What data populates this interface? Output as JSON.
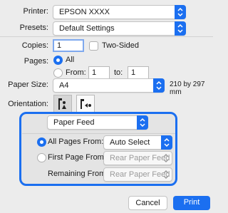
{
  "printer": {
    "label": "Printer:",
    "value": "EPSON XXXX"
  },
  "presets": {
    "label": "Presets:",
    "value": "Default Settings"
  },
  "copies": {
    "label": "Copies:",
    "value": "1",
    "two_sided_label": "Two-Sided"
  },
  "pages": {
    "label": "Pages:",
    "all_label": "All",
    "from_label": "From:",
    "from_value": "1",
    "to_label": "to:",
    "to_value": "1"
  },
  "paper_size": {
    "label": "Paper Size:",
    "value": "A4",
    "dimensions": "210 by 297 mm"
  },
  "orientation": {
    "label": "Orientation:"
  },
  "section": {
    "value": "Paper Feed"
  },
  "paper_feed": {
    "all_pages_label": "All Pages From:",
    "all_pages_value": "Auto Select",
    "first_page_label": "First Page From:",
    "first_page_value": "Rear Paper Feed",
    "remaining_label": "Remaining From:",
    "remaining_value": "Rear Paper Feed"
  },
  "buttons": {
    "cancel": "Cancel",
    "print": "Print"
  },
  "colors": {
    "accent": "#1b6ff0",
    "background": "#ececec"
  }
}
